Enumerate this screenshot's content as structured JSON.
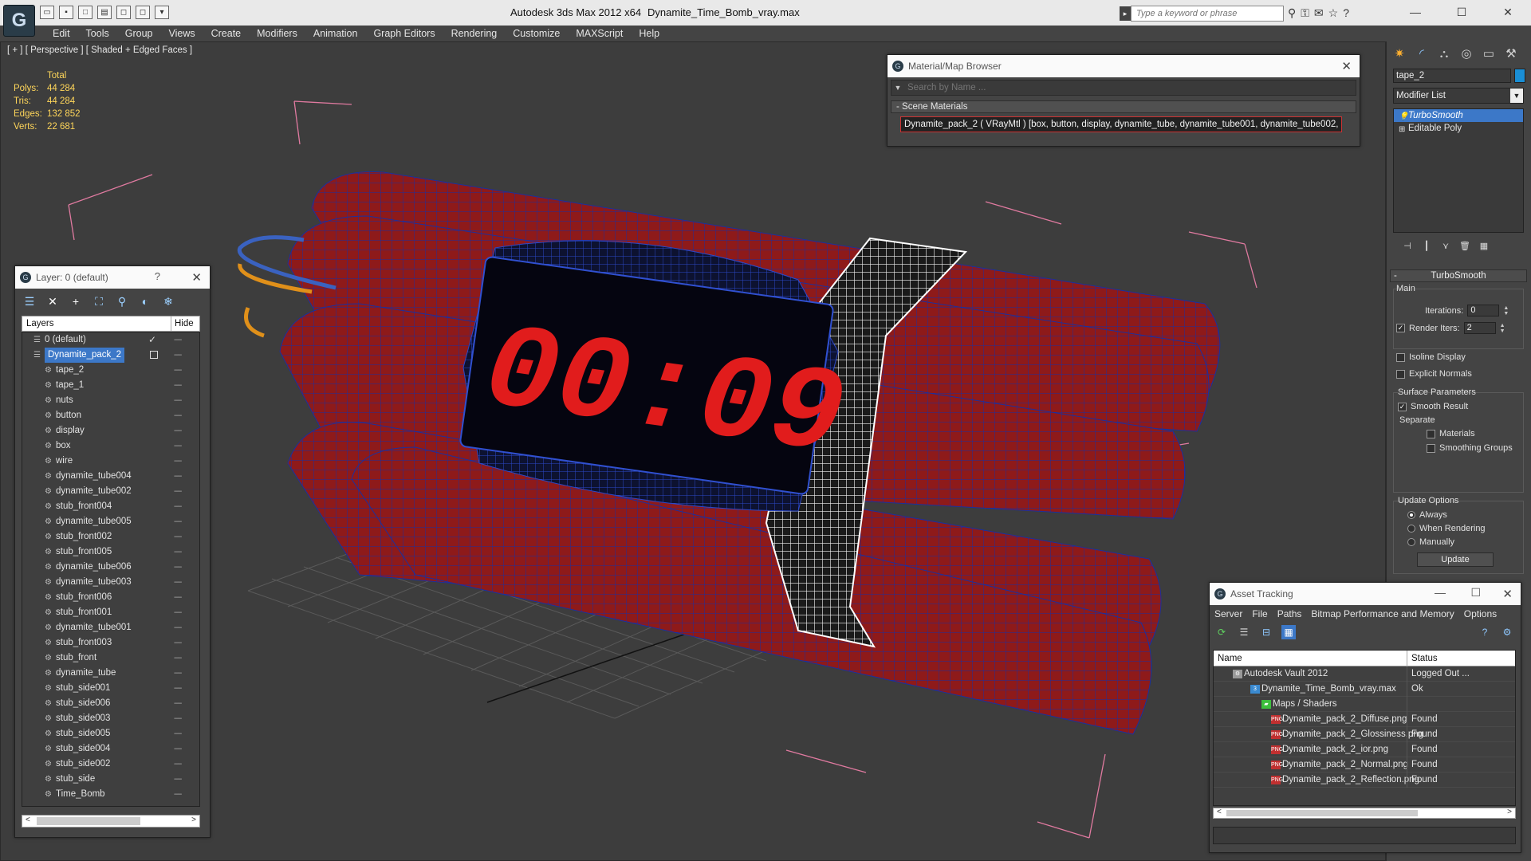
{
  "app": {
    "title": "Autodesk 3ds Max  2012 x64",
    "file": "Dynamite_Time_Bomb_vray.max",
    "search_placeholder": "Type a keyword or phrase",
    "logo_glyph": "G"
  },
  "menu": [
    "Edit",
    "Tools",
    "Group",
    "Views",
    "Create",
    "Modifiers",
    "Animation",
    "Graph Editors",
    "Rendering",
    "Customize",
    "MAXScript",
    "Help"
  ],
  "viewport": {
    "label": "[ + ] [ Perspective ] [ Shaded + Edged Faces ]",
    "stats_header": "Total",
    "stats": [
      {
        "label": "Polys:",
        "value": "44 284"
      },
      {
        "label": "Tris:",
        "value": "44 284"
      },
      {
        "label": "Edges:",
        "value": "132 852"
      },
      {
        "label": "Verts:",
        "value": "22 681"
      }
    ],
    "timer_display": "00:09"
  },
  "material_browser": {
    "title": "Material/Map Browser",
    "search_placeholder": "Search by Name ...",
    "section": "- Scene Materials",
    "item": "Dynamite_pack_2  ( VRayMtl ) [box, button, display, dynamite_tube, dynamite_tube001, dynamite_tube002, d..."
  },
  "layers": {
    "title": "Layer: 0 (default)",
    "help": "?",
    "col_layers": "Layers",
    "col_hide": "Hide",
    "rows": [
      {
        "name": "0 (default)",
        "level": 0,
        "type": "layer",
        "checked": true
      },
      {
        "name": "Dynamite_pack_2",
        "level": 0,
        "type": "layer",
        "selected": true
      },
      {
        "name": "tape_2",
        "level": 1,
        "type": "object"
      },
      {
        "name": "tape_1",
        "level": 1,
        "type": "object"
      },
      {
        "name": "nuts",
        "level": 1,
        "type": "object"
      },
      {
        "name": "button",
        "level": 1,
        "type": "object"
      },
      {
        "name": "display",
        "level": 1,
        "type": "object"
      },
      {
        "name": "box",
        "level": 1,
        "type": "object"
      },
      {
        "name": "wire",
        "level": 1,
        "type": "object"
      },
      {
        "name": "dynamite_tube004",
        "level": 1,
        "type": "object"
      },
      {
        "name": "dynamite_tube002",
        "level": 1,
        "type": "object"
      },
      {
        "name": "stub_front004",
        "level": 1,
        "type": "object"
      },
      {
        "name": "dynamite_tube005",
        "level": 1,
        "type": "object"
      },
      {
        "name": "stub_front002",
        "level": 1,
        "type": "object"
      },
      {
        "name": "stub_front005",
        "level": 1,
        "type": "object"
      },
      {
        "name": "dynamite_tube006",
        "level": 1,
        "type": "object"
      },
      {
        "name": "dynamite_tube003",
        "level": 1,
        "type": "object"
      },
      {
        "name": "stub_front006",
        "level": 1,
        "type": "object"
      },
      {
        "name": "stub_front001",
        "level": 1,
        "type": "object"
      },
      {
        "name": "dynamite_tube001",
        "level": 1,
        "type": "object"
      },
      {
        "name": "stub_front003",
        "level": 1,
        "type": "object"
      },
      {
        "name": "stub_front",
        "level": 1,
        "type": "object"
      },
      {
        "name": "dynamite_tube",
        "level": 1,
        "type": "object"
      },
      {
        "name": "stub_side001",
        "level": 1,
        "type": "object"
      },
      {
        "name": "stub_side006",
        "level": 1,
        "type": "object"
      },
      {
        "name": "stub_side003",
        "level": 1,
        "type": "object"
      },
      {
        "name": "stub_side005",
        "level": 1,
        "type": "object"
      },
      {
        "name": "stub_side004",
        "level": 1,
        "type": "object"
      },
      {
        "name": "stub_side002",
        "level": 1,
        "type": "object"
      },
      {
        "name": "stub_side",
        "level": 1,
        "type": "object"
      },
      {
        "name": "Time_Bomb",
        "level": 1,
        "type": "object"
      }
    ]
  },
  "command_panel": {
    "object_name": "tape_2",
    "object_color": "#1a8fd6",
    "modifier_list": "Modifier List",
    "stack": [
      {
        "name": "TurboSmooth",
        "selected": true
      },
      {
        "name": "Editable Poly",
        "selected": false
      }
    ],
    "rollout": "TurboSmooth",
    "main_label": "Main",
    "iterations_label": "Iterations:",
    "iterations_value": "0",
    "render_iters_label": "Render Iters:",
    "render_iters_value": "2",
    "isoline_label": "Isoline Display",
    "explicit_label": "Explicit Normals",
    "surface_label": "Surface Parameters",
    "smooth_label": "Smooth Result",
    "separate_label": "Separate",
    "materials_label": "Materials",
    "smoothing_label": "Smoothing Groups",
    "update_options_label": "Update Options",
    "always_label": "Always",
    "when_rendering_label": "When Rendering",
    "manually_label": "Manually",
    "update_button": "Update"
  },
  "asset_tracking": {
    "title": "Asset Tracking",
    "menu": [
      "Server",
      "File",
      "Paths",
      "Bitmap Performance and Memory",
      "Options"
    ],
    "col_name": "Name",
    "col_status": "Status",
    "rows": [
      {
        "name": "Autodesk Vault 2012",
        "status": "Logged Out ...",
        "indent": 24,
        "icon": "vault"
      },
      {
        "name": "Dynamite_Time_Bomb_vray.max",
        "status": "Ok",
        "indent": 46,
        "icon": "max"
      },
      {
        "name": "Maps / Shaders",
        "status": "",
        "indent": 60,
        "icon": "folder"
      },
      {
        "name": "Dynamite_pack_2_Diffuse.png",
        "status": "Found",
        "indent": 72,
        "icon": "png"
      },
      {
        "name": "Dynamite_pack_2_Glossiness.png",
        "status": "Found",
        "indent": 72,
        "icon": "png"
      },
      {
        "name": "Dynamite_pack_2_ior.png",
        "status": "Found",
        "indent": 72,
        "icon": "png"
      },
      {
        "name": "Dynamite_pack_2_Normal.png",
        "status": "Found",
        "indent": 72,
        "icon": "png"
      },
      {
        "name": "Dynamite_pack_2_Reflection.png",
        "status": "Found",
        "indent": 72,
        "icon": "png"
      }
    ]
  }
}
